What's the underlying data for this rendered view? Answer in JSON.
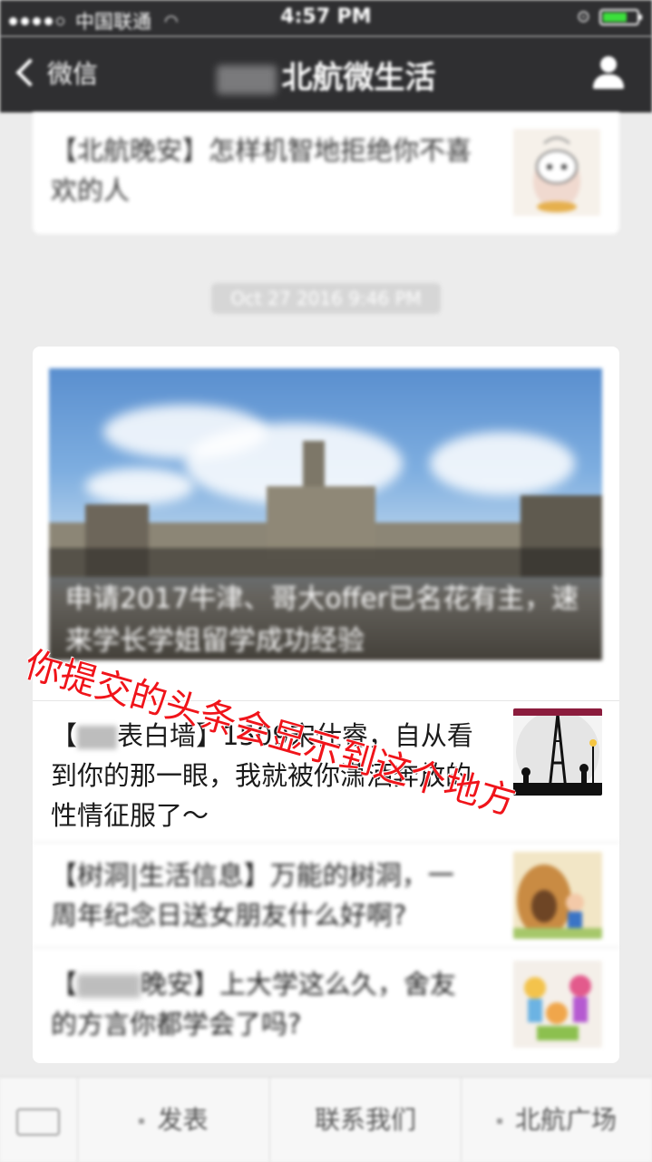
{
  "status_bar": {
    "carrier": "中国联通",
    "time": "4:57 PM"
  },
  "nav": {
    "back_label": "微信",
    "title": "北航微生活"
  },
  "articles": [
    {
      "title": "【北航晚安】怎样机智地拒绝你不喜欢的人"
    }
  ],
  "timestamp": "Oct 27 2016 9:46 PM",
  "feature": {
    "hero_caption": "申请2017牛津、哥大offer已名花有主，速来学长学姐留学成功经验",
    "items": [
      {
        "prefix_hidden": "【",
        "title": "表白墙】1509宋仕睿，自从看到你的那一眼，我就被你潇洒奔放的性情征服了～"
      },
      {
        "title": "【树洞|生活信息】万能的树洞，一周年纪念日送女朋友什么好啊?"
      },
      {
        "prefix_hidden": "【",
        "title": "晚安】上大学这么久，舍友的方言你都学会了吗?"
      }
    ]
  },
  "menu": {
    "items": [
      "发表",
      "联系我们",
      "北航广场"
    ]
  },
  "annotation": "你提交的头条会显示到这个地方",
  "icons": {
    "back": "chevron-left-icon",
    "profile": "person-icon",
    "keyboard": "keyboard-icon"
  },
  "colors": {
    "navbar": "#2f2f31",
    "annotation": "#f0141a",
    "background": "#ececec"
  }
}
